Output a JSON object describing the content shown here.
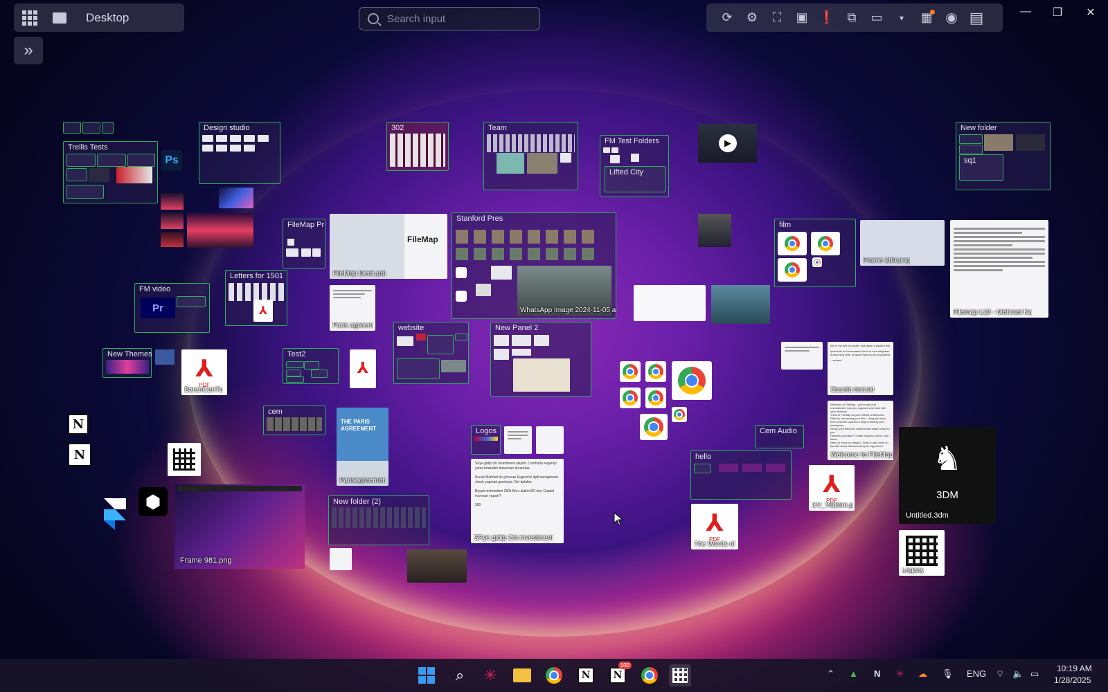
{
  "topbar": {
    "workspace_label": "Desktop",
    "search": {
      "placeholder": "Search input"
    },
    "toolbar_icons": [
      "refresh-icon",
      "settings-icon",
      "fullscreen-icon",
      "profile-icon",
      "alert-icon",
      "sharescreen-icon",
      "display-icon",
      "dropdown-icon",
      "film-icon",
      "discord-icon",
      "filemap-icon"
    ],
    "window_controls": {
      "minimize": "—",
      "maximize": "❐",
      "close": "✕"
    },
    "expand": "»"
  },
  "panels": {
    "trellis": "Trellis Tests",
    "design_studio": "Design studio",
    "p302": "302",
    "team": "Team",
    "fm_test_folders": "FM Test Folders",
    "lifted_city": "Lifted City",
    "new_folder": "New folder",
    "sq1": "sq1",
    "filemap_pr": "FileMap Pr",
    "stanford_pres": "Stanford Pres",
    "letters": "Letters for 1501",
    "fm_video": "FM video",
    "film": "film",
    "new_themes": "New Themes",
    "test2": "Test2",
    "website": "website",
    "new_panel2": "New Panel 2",
    "cem": "cem",
    "logos": "Logos",
    "cem_audio": "Cem Audio",
    "hello": "hello",
    "new_folder2": "New folder (2)"
  },
  "files": {
    "filemap_deck": "FileMap Deck.pdf",
    "whatsapp": "WhatsApp Image 2024-11-05 a",
    "paris_agree": "Paris agreem",
    "baran": "BaranCanTu",
    "paris_agreement2": "Parisagreemen",
    "frame981": "Frame 981.png",
    "sfye": "SFye gidip 2m investment",
    "frame280": "Frame 280.png",
    "filemap_loi": "Filemap LOI - Mehmet Ka",
    "ozanla": "Ozanla test.txt",
    "welcome": "Welcome to FileMap",
    "cv": "CV_Yildirim.p",
    "words": "The Words of",
    "untitled3dm": "Untitled.3dm",
    "legacy": "Legacy"
  },
  "card_text": {
    "filemap_logo": "FileMap",
    "paris_cover": "THE PARIS AGREEMENT",
    "rhino": "3DM",
    "pdf_badge": "PDF",
    "ps": "Ps",
    "pr": "Pr",
    "sfye_lines": [
      "SFye gidip 2m investment alayim. Cumhurla evgeniyi yaniz birakalim dusunsun dursunlar.",
      "Kucuk Mehmet ile gorusup Evgeni ile ilgili background check yapmak gerekiyor. Dirt bulalim.",
      "Buyuk mehmetten 250k Borc alalim BG den Capital increase yapsin?",
      "280"
    ],
    "ozanla_lines": [
      "this is my test txt profile. Ima attain a hacked test",
      "qdsowldo dod nomnasef this is of ome kskjsalas a asdo dog ower ns golds daw dj ndo dog awesk",
      "...asdasd"
    ],
    "welcome_lines": [
      "Welcome to FileMap - you're about to revolutionise how you organize and work with your desktop!",
      "Think of FileMap as your infinite whiteboard. Start by connecting your files - drag and drop them onto the canvas to begin creating your workspace.",
      "Group your files into clusters that make sense to you.",
      "Planning a project? Create a space just for your ideas.",
      "Need to focus on details? Zoom in and work on specific areas without losing the big picture."
    ]
  },
  "taskbar": {
    "apps": [
      "windows-start-icon",
      "search-icon",
      "slack-icon",
      "file-explorer-icon",
      "chrome-icon",
      "notion-icon",
      "notion-calendar-icon",
      "chrome-profile-icon",
      "filemap-icon"
    ],
    "notion_badge": "100",
    "lang": "ENG",
    "time": "10:19 AM",
    "date": "1/28/2025"
  },
  "colors": {
    "panel_border": "#2eae5e",
    "accent_orange": "#ff7a2a"
  }
}
